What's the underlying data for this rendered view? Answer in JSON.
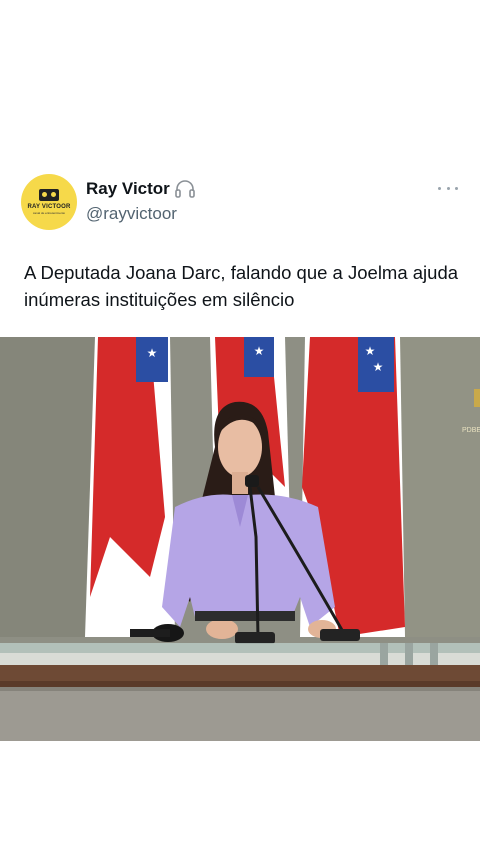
{
  "user": {
    "display_name": "Ray Victor",
    "handle": "@rayvictoor",
    "avatar_text": "RAY VICTOOR",
    "avatar_subtext": "canal de entretenimento",
    "badge_icon": "headphones-icon"
  },
  "tweet": {
    "text": "A Deputada Joana Darc, falando que a Joelma ajuda inúmeras instituições em silêncio",
    "more_icon": "more-options-icon"
  },
  "media": {
    "description_type": "video-frame",
    "watermark": "PDBE"
  },
  "colors": {
    "background": "#ffffff",
    "text_primary": "#0f1419",
    "text_secondary": "#536471",
    "avatar_bg": "#f6d94a",
    "flag_red": "#d52a2a",
    "flag_blue": "#2b4ea3",
    "blouse": "#b5a5e6"
  }
}
